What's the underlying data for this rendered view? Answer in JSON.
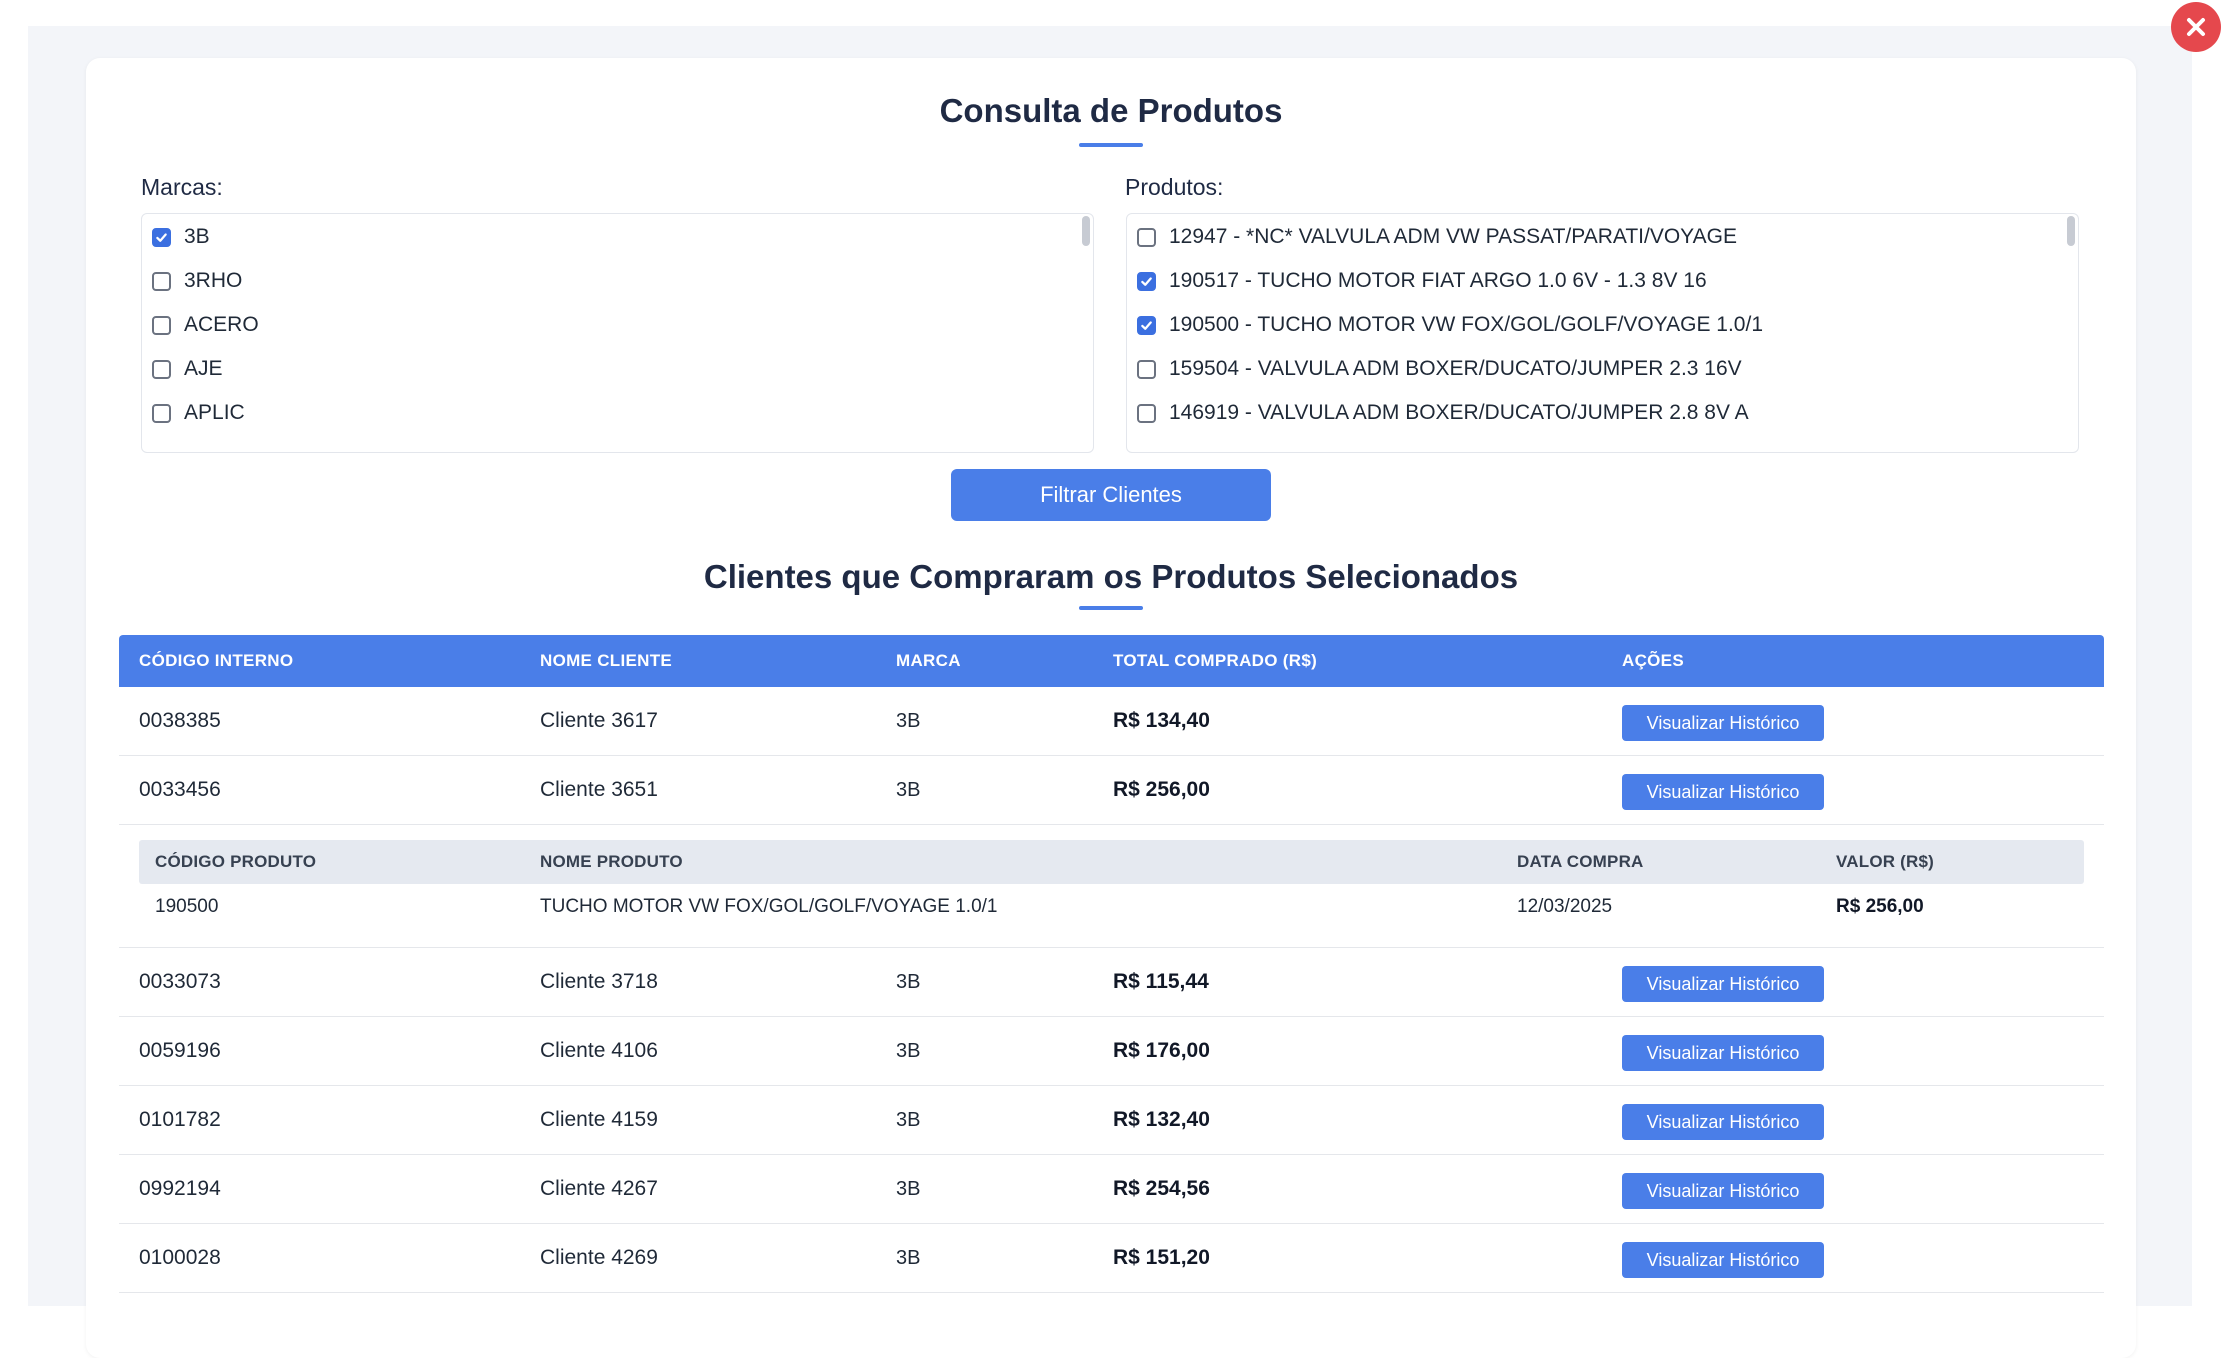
{
  "page": {
    "title": "Consulta de Produtos",
    "subtitle": "Clientes que Compraram os Produtos Selecionados",
    "close_icon": "close-icon",
    "accent_color": "#4a7ee8"
  },
  "brands": {
    "label": "Marcas:",
    "items": [
      {
        "label": "3B",
        "checked": true
      },
      {
        "label": "3RHO",
        "checked": false
      },
      {
        "label": "ACERO",
        "checked": false
      },
      {
        "label": "AJE",
        "checked": false
      },
      {
        "label": "APLIC",
        "checked": false
      }
    ]
  },
  "products": {
    "label": "Produtos:",
    "items": [
      {
        "label": "12947 - *NC* VALVULA ADM VW PASSAT/PARATI/VOYAGE",
        "checked": false
      },
      {
        "label": "190517 - TUCHO MOTOR FIAT ARGO 1.0 6V - 1.3 8V 16",
        "checked": true
      },
      {
        "label": "190500 - TUCHO MOTOR VW FOX/GOL/GOLF/VOYAGE 1.0/1",
        "checked": true
      },
      {
        "label": "159504 - VALVULA ADM BOXER/DUCATO/JUMPER 2.3 16V",
        "checked": false
      },
      {
        "label": "146919 - VALVULA ADM BOXER/DUCATO/JUMPER 2.8 8V A",
        "checked": false
      }
    ]
  },
  "filter_button": "Filtrar Clientes",
  "table": {
    "headers": {
      "code": "CÓDIGO INTERNO",
      "name": "NOME CLIENTE",
      "brand": "MARCA",
      "total": "TOTAL COMPRADO (R$)",
      "actions": "AÇÕES"
    },
    "action_label": "Visualizar Histórico",
    "rows": [
      {
        "code": "0038385",
        "name": "Cliente 3617",
        "brand": "3B",
        "total": "R$ 134,40"
      },
      {
        "code": "0033456",
        "name": "Cliente 3651",
        "brand": "3B",
        "total": "R$ 256,00"
      },
      {
        "code": "0033073",
        "name": "Cliente 3718",
        "brand": "3B",
        "total": "R$ 115,44"
      },
      {
        "code": "0059196",
        "name": "Cliente 4106",
        "brand": "3B",
        "total": "R$ 176,00"
      },
      {
        "code": "0101782",
        "name": "Cliente 4159",
        "brand": "3B",
        "total": "R$ 132,40"
      },
      {
        "code": "0992194",
        "name": "Cliente 4267",
        "brand": "3B",
        "total": "R$ 254,56"
      },
      {
        "code": "0100028",
        "name": "Cliente 4269",
        "brand": "3B",
        "total": "R$ 151,20"
      }
    ],
    "history": {
      "headers": {
        "code": "CÓDIGO PRODUTO",
        "name": "NOME PRODUTO",
        "date": "DATA COMPRA",
        "value": "VALOR (R$)"
      },
      "items": [
        {
          "code": "190500",
          "name": "TUCHO MOTOR VW FOX/GOL/GOLF/VOYAGE 1.0/1",
          "date": "12/03/2025",
          "value": "R$ 256,00"
        }
      ]
    }
  }
}
